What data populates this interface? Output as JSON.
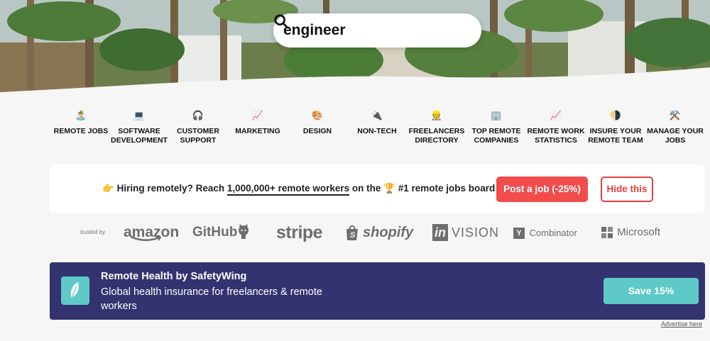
{
  "search": {
    "value": "engineer"
  },
  "categories": [
    {
      "emoji": "🏝️",
      "label": "REMOTE JOBS"
    },
    {
      "emoji": "💻",
      "label": "SOFTWARE DEVELOPMENT"
    },
    {
      "emoji": "🎧",
      "label": "CUSTOMER SUPPORT"
    },
    {
      "emoji": "📈",
      "label": "MARKETING"
    },
    {
      "emoji": "🎨",
      "label": "DESIGN"
    },
    {
      "emoji": "🔌",
      "label": "NON-TECH"
    },
    {
      "emoji": "👷",
      "label": "FREELANCERS DIRECTORY"
    },
    {
      "emoji": "🏢",
      "label": "TOP REMOTE COMPANIES"
    },
    {
      "emoji": "📈",
      "label": "REMOTE WORK STATISTICS"
    },
    {
      "emoji": "🌗",
      "label": "INSURE YOUR REMOTE TEAM"
    },
    {
      "emoji": "⚒️",
      "label": "MANAGE YOUR JOBS"
    }
  ],
  "hiring": {
    "icon": "👉",
    "text_a": "Hiring remotely? Reach ",
    "link": "1,000,000+ remote workers",
    "text_b": " on the ",
    "trophy": "🏆",
    "text_c": " #1 remote jobs board",
    "post_label": "Post a job (-25%)",
    "hide_label": "Hide this"
  },
  "trusted": {
    "label": "trusted by",
    "logos": [
      "amazon",
      "GitHub",
      "stripe",
      "shopify",
      "in",
      "VISION",
      "Y",
      "Combinator",
      "Microsoft"
    ]
  },
  "ad": {
    "title": "Remote Health by SafetyWing",
    "description": "Global health insurance for freelancers & remote workers",
    "button": "Save 15%",
    "advertise": "Advertise here"
  },
  "colors": {
    "post": "#f24c4c",
    "ad_bg": "#32336f",
    "ad_accent": "#5ec9c6"
  }
}
